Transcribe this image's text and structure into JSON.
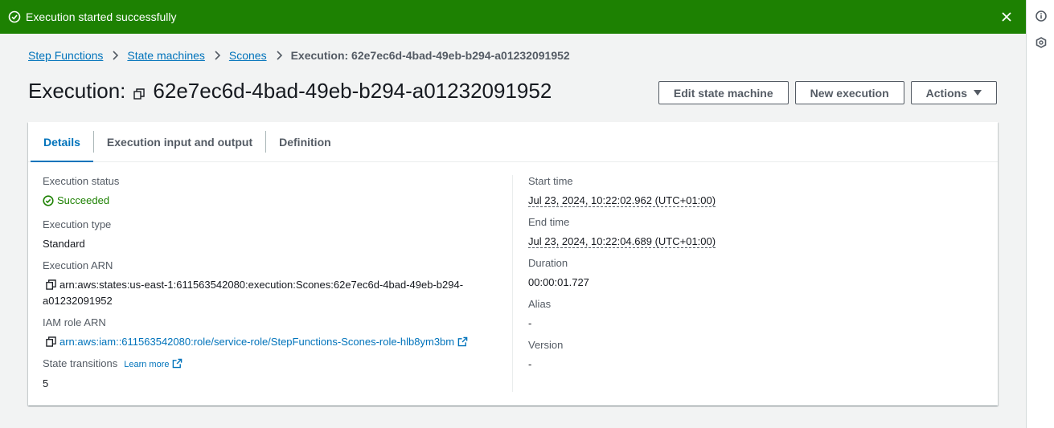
{
  "flash": {
    "message": "Execution started successfully",
    "color": "#1d8102"
  },
  "breadcrumb": {
    "items": [
      "Step Functions",
      "State machines",
      "Scones"
    ],
    "current": "Execution: 62e7ec6d-4bad-49eb-b294-a01232091952"
  },
  "header": {
    "title_prefix": "Execution:",
    "title_id": "62e7ec6d-4bad-49eb-b294-a01232091952",
    "buttons": {
      "edit": "Edit state machine",
      "new": "New execution",
      "actions": "Actions"
    }
  },
  "tabs": [
    "Details",
    "Execution input and output",
    "Definition"
  ],
  "details": {
    "left": {
      "status_label": "Execution status",
      "status_value": "Succeeded",
      "type_label": "Execution type",
      "type_value": "Standard",
      "arn_label": "Execution ARN",
      "arn_value_line1": "arn:aws:states:us-east-1:611563542080:execution:Scones:62e7ec6d-4bad-49eb-b294-",
      "arn_value_line2": "a01232091952",
      "iam_label": "IAM role ARN",
      "iam_value": "arn:aws:iam::611563542080:role/service-role/StepFunctions-Scones-role-hlb8ym3bm",
      "transitions_label": "State transitions",
      "learn_more": "Learn more",
      "transitions_value": "5"
    },
    "right": {
      "start_label": "Start time",
      "start_value": "Jul 23, 2024, 10:22:02.962 (UTC+01:00)",
      "end_label": "End time",
      "end_value": "Jul 23, 2024, 10:22:04.689 (UTC+01:00)",
      "duration_label": "Duration",
      "duration_value": "00:00:01.727",
      "alias_label": "Alias",
      "alias_value": "-",
      "version_label": "Version",
      "version_value": "-"
    }
  },
  "icons": {
    "flash": "check-circle-icon",
    "close": "close-icon",
    "rail": [
      "info-icon",
      "hexagon-icon"
    ],
    "copy": "copy-icon",
    "external": "external-link-icon"
  }
}
